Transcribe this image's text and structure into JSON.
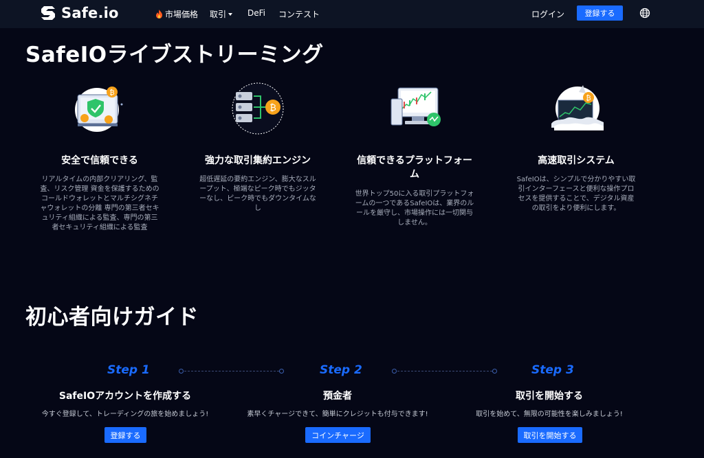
{
  "nav": {
    "logo": "Safe.io",
    "links": [
      "市場価格",
      "取引",
      "DeFi",
      "コンテスト"
    ],
    "login": "ログイン",
    "signup": "登録する",
    "globe_icon": "globe-icon"
  },
  "streaming": {
    "title": "SafeIOライブストリーミング",
    "features": [
      {
        "title": "安全で信頼できる",
        "desc": [
          "リアルタイムの内部クリアリング、監",
          "査、リスク管理 資金を保護するための",
          "コールドウォレットとマルチシグネチ",
          "ャウォレットの分離 専門の第三者セキ",
          "ュリティ組織による監査、専門の第三",
          "者セキュリティ組織による監査"
        ]
      },
      {
        "title": "強力な取引集約エンジン",
        "desc": [
          "超低遅延の要約エンジン、膨大なスル",
          "ープット、極端なピーク時でもジッタ",
          "ーなし、ピーク時でもダウンタイムな",
          "し"
        ]
      },
      {
        "title_lines": [
          "信頼できるプラットフォー",
          "ム"
        ],
        "desc": [
          "世界トップ50に入る取引プラットフォ",
          "ームの一つであるSafeIOは、業界のル",
          "ールを厳守し、市場操作には一切関与",
          "しません。"
        ]
      },
      {
        "title": "高速取引システム",
        "desc": [
          "SafeIOは、シンプルで分かりやすい取",
          "引インターフェースと便利な操作プロ",
          "セスを提供することで、デジタル資産",
          "の取引をより便利にします。"
        ]
      }
    ]
  },
  "guide": {
    "title": "初心者向けガイド",
    "steps": [
      {
        "label": "Step 1",
        "title": "SafeIOアカウントを作成する",
        "desc": "今すぐ登録して、トレーディングの旅を始めましょう!",
        "button": "登録する"
      },
      {
        "label": "Step 2",
        "title": "預金者",
        "desc": "素早くチャージできて、簡単にクレジットも付与できます!",
        "button": "コインチャージ"
      },
      {
        "label": "Step 3",
        "title": "取引を開始する",
        "desc": "取引を始めて、無限の可能性を楽しみましょう!",
        "button": "取引を開始する"
      }
    ]
  },
  "colors": {
    "accent": "#1a6bff",
    "background": "#050716",
    "nav": "#0d1424",
    "muted": "#a7adbb",
    "coin": "#f7a21b",
    "green": "#2fc46a"
  }
}
